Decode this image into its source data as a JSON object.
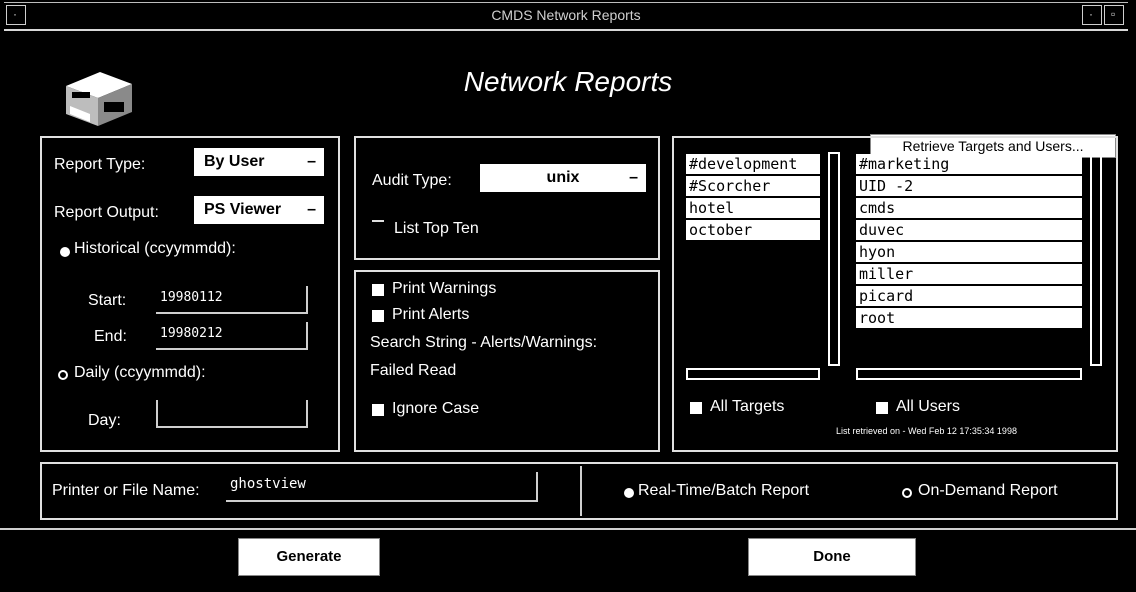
{
  "window": {
    "title": "CMDS Network Reports"
  },
  "header": {
    "title": "Network Reports",
    "retrieve_button": "Retrieve Targets and Users..."
  },
  "report": {
    "type_label": "Report Type:",
    "type_value": "By User",
    "output_label": "Report Output:",
    "output_value": "PS Viewer",
    "historical_label": "Historical (ccyymmdd):",
    "start_label": "Start:",
    "start_value": "19980112",
    "end_label": "End:",
    "end_value": "19980212",
    "daily_label": "Daily (ccyymmdd):",
    "day_label": "Day:",
    "day_value": ""
  },
  "audit": {
    "type_label": "Audit Type:",
    "type_value": "unix",
    "list_top_ten": "List Top Ten"
  },
  "options": {
    "print_warnings": "Print Warnings",
    "print_alerts": "Print Alerts",
    "search_label": "Search String - Alerts/Warnings:",
    "search_value": "Failed Read",
    "ignore_case": "Ignore Case"
  },
  "targets": {
    "items": [
      "#development",
      "#Scorcher",
      "hotel",
      "october"
    ],
    "all_label": "All Targets"
  },
  "users": {
    "items": [
      "#marketing",
      "UID -2",
      "cmds",
      "duvec",
      "hyon",
      "miller",
      "picard",
      "root"
    ],
    "all_label": "All Users",
    "retrieved_text": "List retrieved on - Wed Feb 12 17:35:34 1998"
  },
  "printer": {
    "label": "Printer or File Name:",
    "value": "ghostview"
  },
  "mode": {
    "realtime_label": "Real-Time/Batch Report",
    "ondemand_label": "On-Demand Report"
  },
  "actions": {
    "generate": "Generate",
    "done": "Done"
  }
}
